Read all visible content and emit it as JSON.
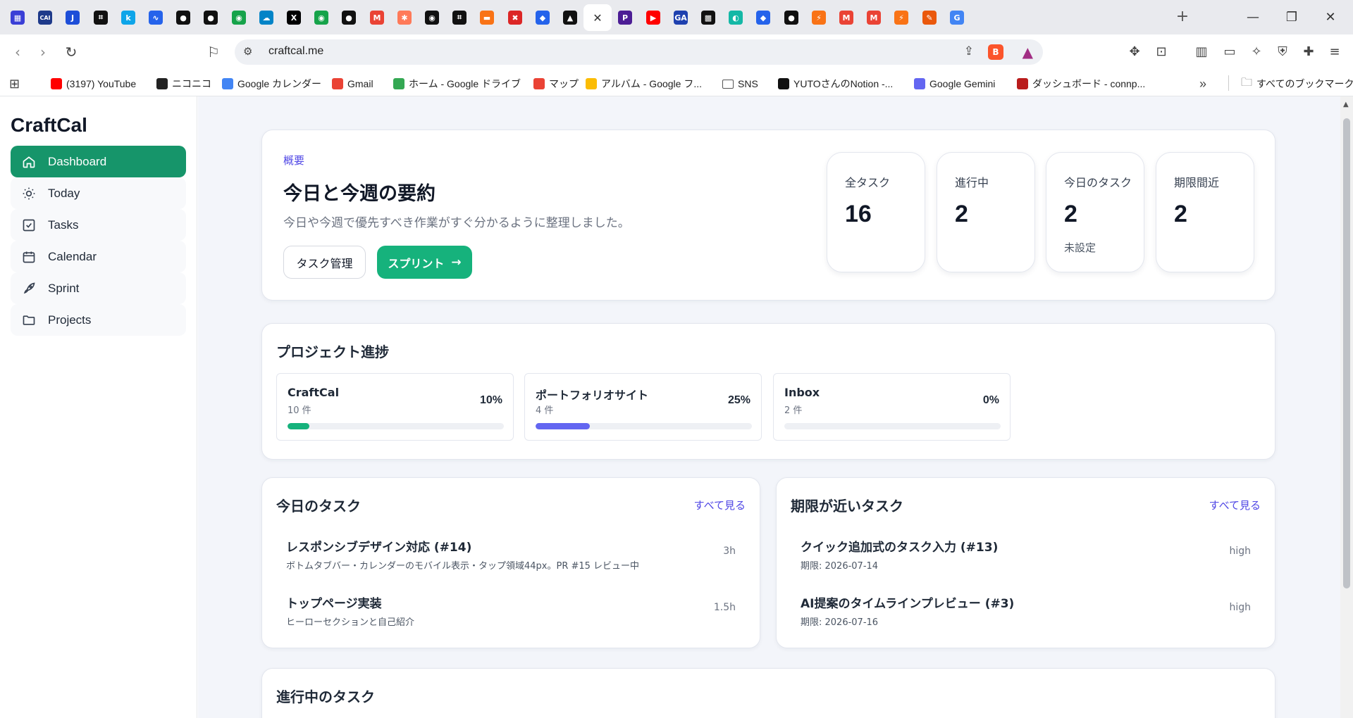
{
  "browser": {
    "tabs": [
      {
        "icon": "grid-blue-icon",
        "color": "#3a3fd6",
        "glyph": "▦"
      },
      {
        "icon": "cai-icon",
        "color": "#1e3a8a",
        "glyph": "CAI"
      },
      {
        "icon": "j-icon",
        "color": "#1d4ed8",
        "glyph": "J"
      },
      {
        "icon": "notion-like-icon",
        "color": "#111111",
        "glyph": "⌗"
      },
      {
        "icon": "k-icon",
        "color": "#0ea5e9",
        "glyph": "k"
      },
      {
        "icon": "swirl-icon",
        "color": "#2563eb",
        "glyph": "∿"
      },
      {
        "icon": "github-icon",
        "color": "#111111",
        "glyph": "●"
      },
      {
        "icon": "github-icon",
        "color": "#111111",
        "glyph": "●"
      },
      {
        "icon": "green-circle-icon",
        "color": "#16a34a",
        "glyph": "◉"
      },
      {
        "icon": "cloud-icon",
        "color": "#0284c7",
        "glyph": "☁"
      },
      {
        "icon": "x-icon",
        "color": "#000000",
        "glyph": "X"
      },
      {
        "icon": "green-circle-icon",
        "color": "#16a34a",
        "glyph": "◉"
      },
      {
        "icon": "github-icon",
        "color": "#111111",
        "glyph": "●"
      },
      {
        "icon": "gmail-icon",
        "color": "#ea4335",
        "glyph": "M"
      },
      {
        "icon": "hubspot-icon",
        "color": "#ff7a59",
        "glyph": "✱"
      },
      {
        "icon": "eye-icon",
        "color": "#111111",
        "glyph": "◉"
      },
      {
        "icon": "notion-like-icon",
        "color": "#111111",
        "glyph": "⌗"
      },
      {
        "icon": "orange-icon",
        "color": "#f97316",
        "glyph": "▬"
      },
      {
        "icon": "ticket-icon",
        "color": "#dc2626",
        "glyph": "✖"
      },
      {
        "icon": "map-pin-icon",
        "color": "#2563eb",
        "glyph": "◆"
      },
      {
        "icon": "triangle-icon",
        "color": "#111111",
        "glyph": "▲"
      },
      {
        "icon": "close-icon",
        "color": "#ffffff",
        "glyph": "✕",
        "active": true
      },
      {
        "icon": "p-icon",
        "color": "#4c1d95",
        "glyph": "P"
      },
      {
        "icon": "youtube-icon",
        "color": "#ff0000",
        "glyph": "▶"
      },
      {
        "icon": "ga-icon",
        "color": "#1e40af",
        "glyph": "GA"
      },
      {
        "icon": "pattern-icon",
        "color": "#111111",
        "glyph": "▩"
      },
      {
        "icon": "copilot-icon",
        "color": "#14b8a6",
        "glyph": "◐"
      },
      {
        "icon": "map-pin-icon",
        "color": "#2563eb",
        "glyph": "◆"
      },
      {
        "icon": "github-icon",
        "color": "#111111",
        "glyph": "●"
      },
      {
        "icon": "zapier-icon",
        "color": "#f97316",
        "glyph": "⚡"
      },
      {
        "icon": "gmail-icon",
        "color": "#ea4335",
        "glyph": "M"
      },
      {
        "icon": "gmail-icon",
        "color": "#ea4335",
        "glyph": "M"
      },
      {
        "icon": "zapier-icon",
        "color": "#f97316",
        "glyph": "⚡"
      },
      {
        "icon": "paint-icon",
        "color": "#ea580c",
        "glyph": "✎"
      },
      {
        "icon": "google-icon",
        "color": "#4285f4",
        "glyph": "G"
      }
    ],
    "url": "craftcal.me",
    "bookmarks": [
      {
        "label": "(3197) YouTube",
        "icon": "youtube-icon",
        "color": "#ff0000"
      },
      {
        "label": "ニコニコ",
        "icon": "niconico-icon",
        "color": "#222222"
      },
      {
        "label": "Google カレンダー",
        "icon": "calendar-icon",
        "color": "#4285f4"
      },
      {
        "label": "Gmail",
        "icon": "gmail-icon",
        "color": "#ea4335"
      },
      {
        "label": "ホーム - Google ドライブ",
        "icon": "drive-icon",
        "color": "#34a853"
      },
      {
        "label": "マップ",
        "icon": "maps-icon",
        "color": "#ea4335"
      },
      {
        "label": "アルバム - Google フ...",
        "icon": "photos-icon",
        "color": "#fbbc04"
      },
      {
        "label": "SNS",
        "icon": "folder-icon",
        "color": "#ffffff"
      },
      {
        "label": "YUTOさんのNotion -...",
        "icon": "notion-icon",
        "color": "#111111"
      },
      {
        "label": "Google Gemini",
        "icon": "gemini-icon",
        "color": "#6366f1"
      },
      {
        "label": "ダッシュボード - connp...",
        "icon": "connpass-icon",
        "color": "#b91c1c"
      }
    ],
    "all_bookmarks": "すべてのブックマーク"
  },
  "sidebar": {
    "brand": "CraftCal",
    "items": [
      {
        "label": "Dashboard",
        "icon": "home-icon",
        "active": true
      },
      {
        "label": "Today",
        "icon": "sun-icon"
      },
      {
        "label": "Tasks",
        "icon": "checkbox-icon"
      },
      {
        "label": "Calendar",
        "icon": "calendar-icon"
      },
      {
        "label": "Sprint",
        "icon": "rocket-icon"
      },
      {
        "label": "Projects",
        "icon": "folder-icon"
      }
    ]
  },
  "summary": {
    "eyebrow": "概要",
    "title": "今日と今週の要約",
    "description": "今日や今週で優先すべき作業がすぐ分かるように整理しました。",
    "btn_tasks": "タスク管理",
    "btn_sprint": "スプリント",
    "stats": [
      {
        "label": "全タスク",
        "value": "16",
        "sub": ""
      },
      {
        "label": "進行中",
        "value": "2",
        "sub": ""
      },
      {
        "label": "今日のタスク",
        "value": "2",
        "sub": "未設定"
      },
      {
        "label": "期限間近",
        "value": "2",
        "sub": ""
      }
    ]
  },
  "progress": {
    "title": "プロジェクト進捗",
    "projects": [
      {
        "name": "CraftCal",
        "count": "10 件",
        "pct_label": "10%",
        "pct": 0.1,
        "color": "#16b27c"
      },
      {
        "name": "ポートフォリオサイト",
        "count": "4 件",
        "pct_label": "25%",
        "pct": 0.25,
        "color": "#6366f1"
      },
      {
        "name": "Inbox",
        "count": "2 件",
        "pct_label": "0%",
        "pct": 0,
        "color": "#16b27c"
      }
    ]
  },
  "today_tasks": {
    "title": "今日のタスク",
    "view_all": "すべて見る",
    "items": [
      {
        "title": "レスポンシブデザイン対応 (#14)",
        "sub": "ボトムタブバー・カレンダーのモバイル表示・タップ領域44px。PR #15 レビュー中",
        "meta": "3h"
      },
      {
        "title": "トップページ実装",
        "sub": "ヒーローセクションと自己紹介",
        "meta": "1.5h"
      }
    ]
  },
  "due_tasks": {
    "title": "期限が近いタスク",
    "view_all": "すべて見る",
    "items": [
      {
        "title": "クイック追加式のタスク入力 (#13)",
        "sub": "期限: 2026-07-14",
        "meta": "high"
      },
      {
        "title": "AI提案のタイムラインプレビュー (#3)",
        "sub": "期限: 2026-07-16",
        "meta": "high"
      }
    ]
  },
  "in_progress": {
    "title": "進行中のタスク"
  }
}
